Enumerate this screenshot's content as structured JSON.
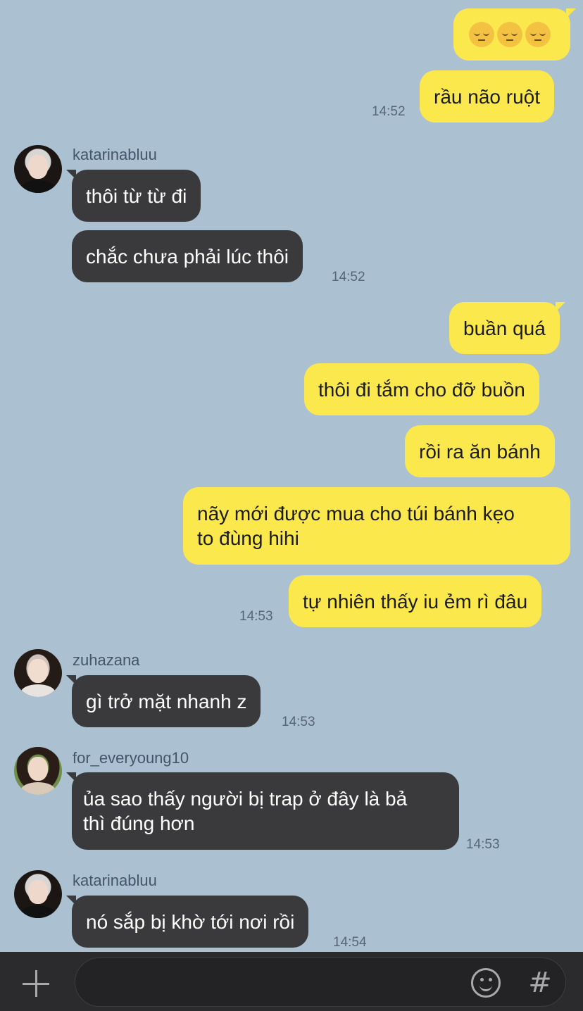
{
  "messages": {
    "m1": "rầu não ruột",
    "t1": "14:52",
    "s1": "katarinabluu",
    "m2": "thôi từ từ đi",
    "m3": "chắc chưa phải lúc thôi",
    "t2": "14:52",
    "m4": "buần quá",
    "m5": "thôi đi tắm cho đỡ buồn",
    "m6": "rồi ra ăn bánh",
    "m7a": "nãy mới được mua cho túi bánh kẹo",
    "m7b": "to đùng hihi",
    "m8": "tự nhiên thấy iu ẻm rì đâu",
    "t3": "14:53",
    "s2": "zuhazana",
    "m9": "gì trở mặt nhanh z",
    "t4": "14:53",
    "s3": "for_everyoung10",
    "m10a": "ủa sao thấy người bị trap ở đây là bả",
    "m10b": "thì đúng hơn",
    "t5": "14:53",
    "s4": "katarinabluu",
    "m11": "nó sắp bị khờ tới nơi rồi",
    "t6": "14:54"
  },
  "composer": {
    "placeholder": ""
  },
  "icons": {
    "emoji_reaction": "pensive-face-icon",
    "add": "plus-icon",
    "emoticon": "smile-icon",
    "hashtag": "hash-icon"
  },
  "colors": {
    "background": "#abc1d1",
    "outgoing": "#fbe84d",
    "incoming": "#3a3a3c"
  }
}
